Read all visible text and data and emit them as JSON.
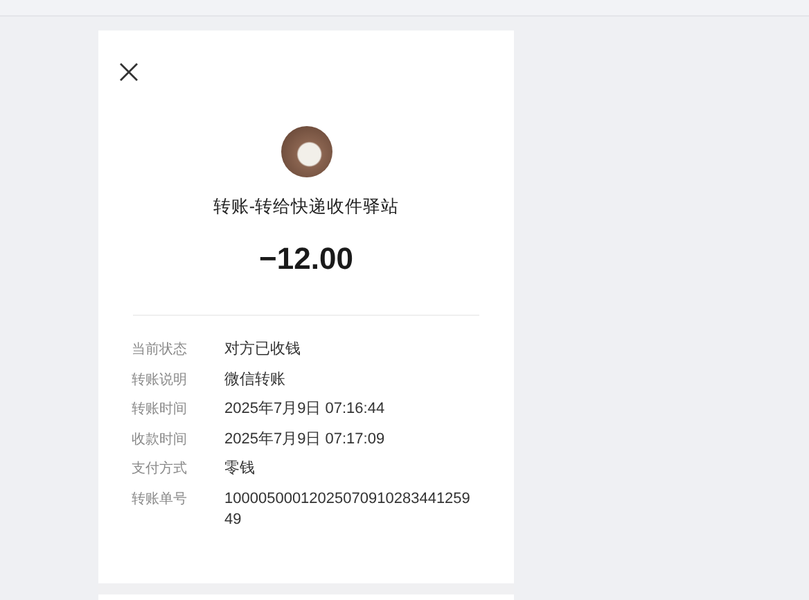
{
  "transfer": {
    "title": "转账-转给快递收件驿站",
    "amount": "−12.00",
    "details": [
      {
        "label": "当前状态",
        "value": "对方已收钱"
      },
      {
        "label": "转账说明",
        "value": "微信转账"
      },
      {
        "label": "转账时间",
        "value": "2025年7月9日 07:16:44"
      },
      {
        "label": "收款时间",
        "value": "2025年7月9日 07:17:09"
      },
      {
        "label": "支付方式",
        "value": "零钱"
      },
      {
        "label": "转账单号",
        "value": "1000050001202507091028344125949"
      }
    ]
  }
}
